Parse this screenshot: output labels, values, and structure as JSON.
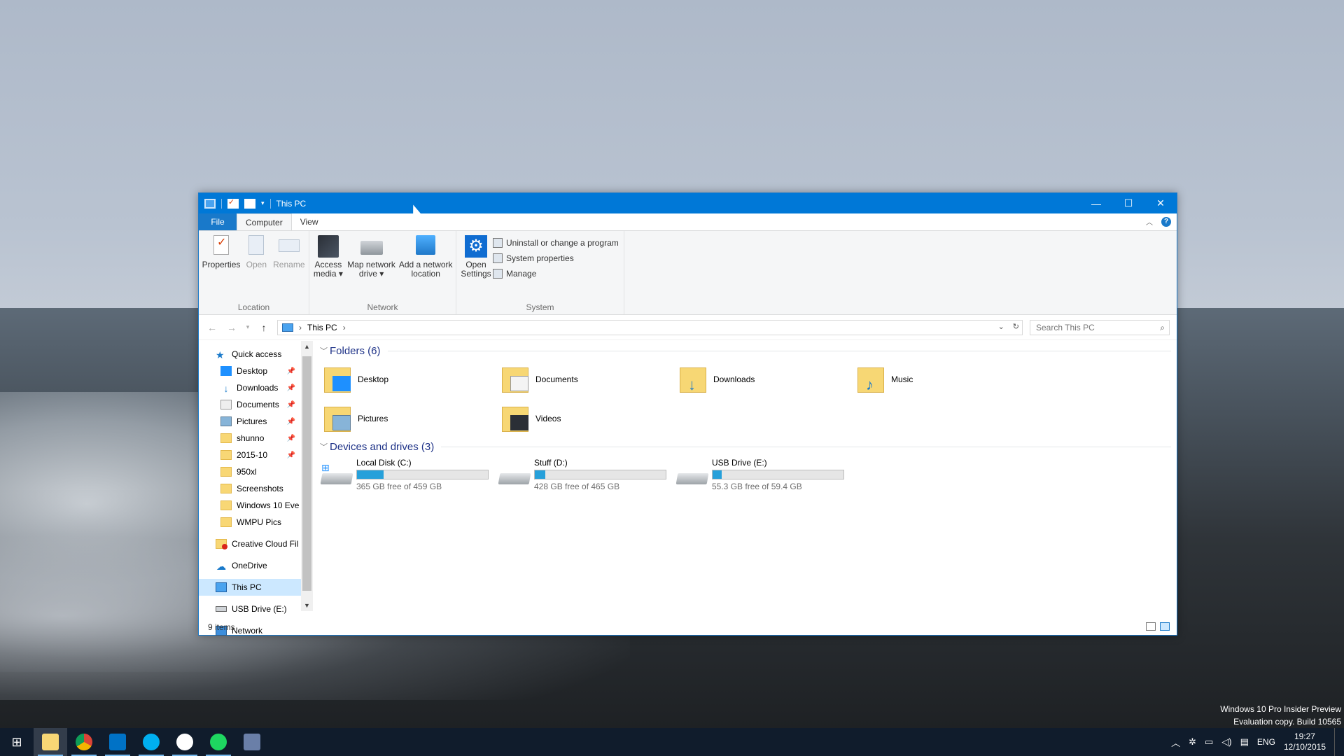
{
  "window": {
    "title": "This PC",
    "controls": {
      "minimize": "—",
      "maximize": "☐",
      "close": "✕"
    }
  },
  "ribbon": {
    "tabs": [
      "File",
      "Computer",
      "View"
    ],
    "groups": {
      "location": {
        "label": "Location",
        "buttons": [
          "Properties",
          "Open",
          "Rename"
        ]
      },
      "network": {
        "label": "Network",
        "access_media": [
          "Access",
          "media ▾"
        ],
        "map_drive": [
          "Map network",
          "drive ▾"
        ],
        "add_location": [
          "Add a network",
          "location"
        ]
      },
      "system": {
        "label": "System",
        "open_settings": [
          "Open",
          "Settings"
        ],
        "small": [
          "Uninstall or change a program",
          "System properties",
          "Manage"
        ]
      }
    }
  },
  "address": {
    "path": "This PC",
    "search_placeholder": "Search This PC"
  },
  "nav": {
    "quick_access": "Quick access",
    "pinned": [
      "Desktop",
      "Downloads",
      "Documents",
      "Pictures",
      "shunno",
      "2015-10"
    ],
    "recent": [
      "950xl",
      "Screenshots",
      "Windows 10 Eve",
      "WMPU Pics"
    ],
    "creative_cloud": "Creative Cloud Fil",
    "onedrive": "OneDrive",
    "this_pc": "This PC",
    "usb": "USB Drive (E:)",
    "network": "Network"
  },
  "content": {
    "folders_header": "Folders (6)",
    "folders": [
      "Desktop",
      "Documents",
      "Downloads",
      "Music",
      "Pictures",
      "Videos"
    ],
    "devices_header": "Devices and drives (3)",
    "drives": [
      {
        "name": "Local Disk (C:)",
        "free": "365 GB free of 459 GB",
        "used_fraction": 0.205
      },
      {
        "name": "Stuff (D:)",
        "free": "428 GB free of 465 GB",
        "used_fraction": 0.08
      },
      {
        "name": "USB Drive (E:)",
        "free": "55.3 GB free of 59.4 GB",
        "used_fraction": 0.069
      }
    ]
  },
  "status": {
    "items": "9 items"
  },
  "watermark": {
    "line1": "Windows 10 Pro Insider Preview",
    "line2": "Evaluation copy. Build 10565"
  },
  "taskbar": {
    "lang": "ENG",
    "time": "19:27",
    "date": "12/10/2015",
    "apps": [
      "start",
      "file-explorer",
      "chrome",
      "outlook",
      "skype",
      "slack",
      "spotify",
      "app"
    ]
  },
  "colors": {
    "accent": "#0078d7",
    "bar_fill": "#26a0da",
    "header_text": "#1e3287"
  }
}
